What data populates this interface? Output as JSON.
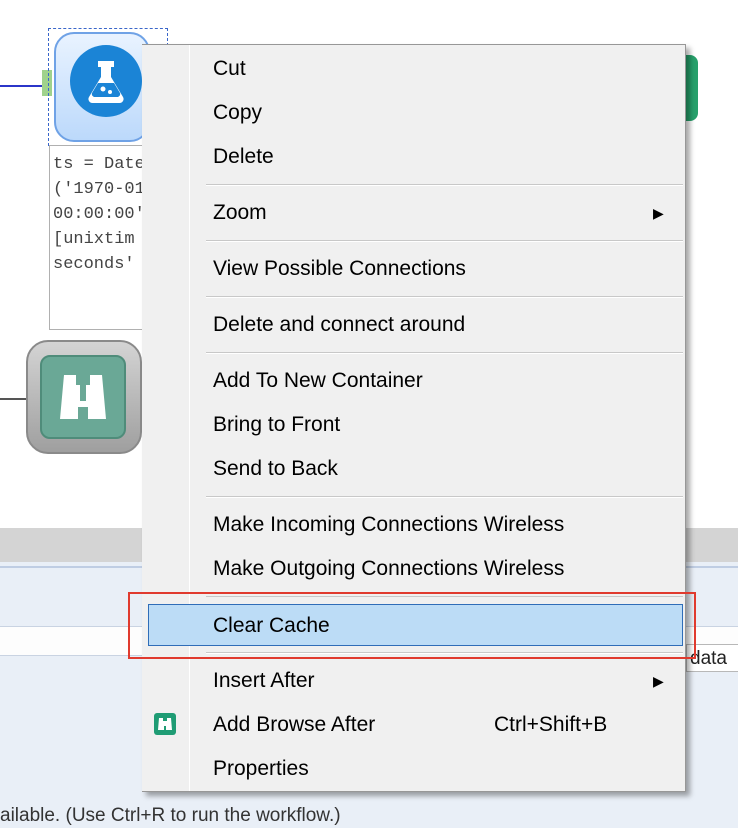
{
  "annotation": {
    "lines": [
      "ts = Date",
      "('1970-01",
      "00:00:00'",
      "[unixtim",
      "seconds'"
    ]
  },
  "context_menu": {
    "items": [
      {
        "label": "Cut"
      },
      {
        "label": "Copy"
      },
      {
        "label": "Delete"
      },
      {
        "label": "Zoom",
        "submenu": true
      },
      {
        "label": "View Possible Connections"
      },
      {
        "label": "Delete and connect around"
      },
      {
        "label": "Add To New Container"
      },
      {
        "label": "Bring to Front"
      },
      {
        "label": "Send to Back"
      },
      {
        "label": "Make Incoming Connections Wireless"
      },
      {
        "label": "Make Outgoing Connections Wireless"
      },
      {
        "label": "Clear Cache",
        "highlighted": true
      },
      {
        "label": "Insert After",
        "submenu": true
      },
      {
        "label": "Add Browse After",
        "shortcut": "Ctrl+Shift+B",
        "icon": "binoculars-icon"
      },
      {
        "label": "Properties"
      }
    ]
  },
  "panel": {
    "data_tag": "data",
    "status": "ailable. (Use Ctrl+R to run the workflow.)"
  },
  "colors": {
    "highlight": "#bcdcf6",
    "annotation_frame": "#e03a2e",
    "formula_tool": "#1b84d6",
    "browse_tool": "#6aa896"
  }
}
